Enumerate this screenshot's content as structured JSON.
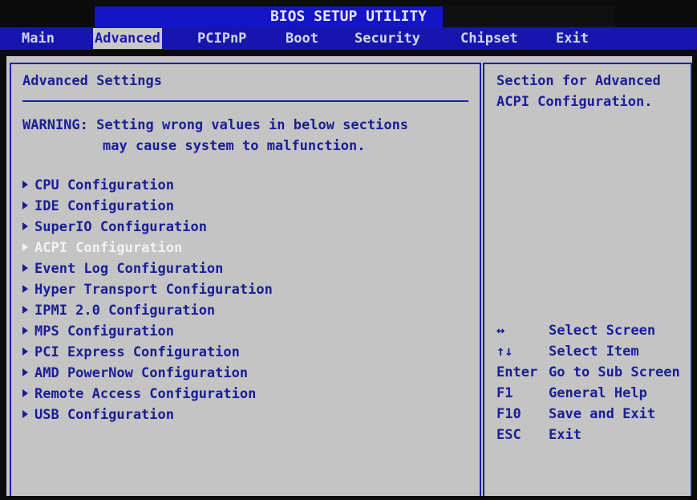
{
  "title": "BIOS SETUP UTILITY",
  "tabs": [
    "Main",
    "Advanced",
    "PCIPnP",
    "Boot",
    "Security",
    "Chipset",
    "Exit"
  ],
  "active_tab": "Advanced",
  "left": {
    "heading": "Advanced Settings",
    "warning_line1": "WARNING: Setting wrong values in below sections",
    "warning_line2": "may cause system to malfunction.",
    "items": [
      {
        "label": "CPU Configuration"
      },
      {
        "label": "IDE Configuration"
      },
      {
        "label": "SuperIO Configuration"
      },
      {
        "label": "ACPI Configuration"
      },
      {
        "label": "Event Log Configuration"
      },
      {
        "label": "Hyper Transport Configuration"
      },
      {
        "label": "IPMI 2.0 Configuration"
      },
      {
        "label": "MPS Configuration"
      },
      {
        "label": "PCI Express Configuration"
      },
      {
        "label": "AMD PowerNow Configuration"
      },
      {
        "label": "Remote Access Configuration"
      },
      {
        "label": "USB Configuration"
      }
    ],
    "selected_item": "ACPI Configuration"
  },
  "help": {
    "line1": "Section for Advanced",
    "line2": "ACPI Configuration."
  },
  "keys": [
    {
      "key": "↔",
      "desc": "Select Screen"
    },
    {
      "key": "↑↓",
      "desc": "Select Item"
    },
    {
      "key": "Enter",
      "desc": "Go to Sub Screen"
    },
    {
      "key": "F1",
      "desc": "General Help"
    },
    {
      "key": "F10",
      "desc": "Save and Exit"
    },
    {
      "key": "ESC",
      "desc": "Exit"
    }
  ],
  "colors": {
    "panel": "#c4c4c4",
    "accent_blue": "#1616ae",
    "text_blue": "#1a1e96",
    "selected_text": "#f2f2f2"
  }
}
